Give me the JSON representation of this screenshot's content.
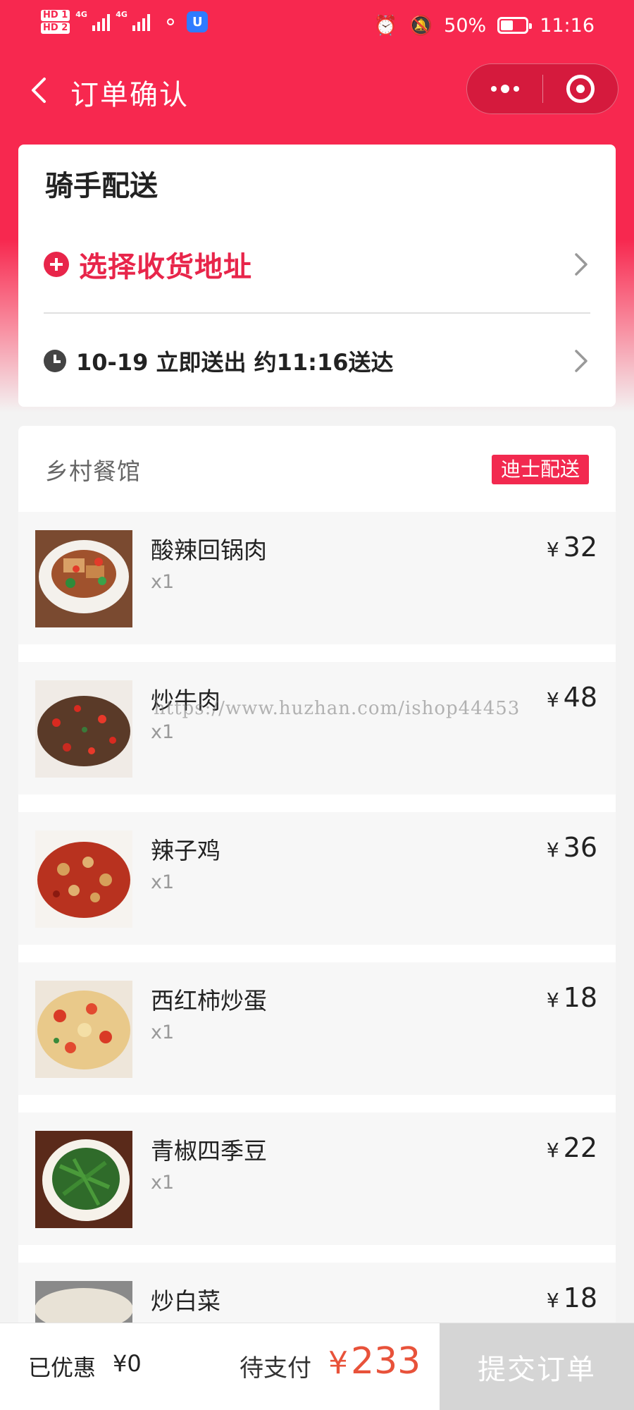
{
  "status_bar": {
    "hd1": "HD 1",
    "hd2": "HD 2",
    "net1": "4G",
    "net2": "4G",
    "battery_text": "50%",
    "battery_level": 0.5,
    "time": "11:16",
    "icons": [
      "alarm-icon",
      "mute-bell-icon",
      "battery-icon"
    ]
  },
  "nav": {
    "title": "订单确认",
    "back_icon": "chevron-left-icon",
    "more_icon": "more-dots-icon",
    "close_icon": "target-circle-icon"
  },
  "delivery": {
    "title": "骑手配送",
    "address_label": "选择收货地址",
    "time_label": "10-19 立即送出 约11:16送达"
  },
  "restaurant": {
    "name": "乡村餐馆",
    "badge": "迪士配送",
    "currency": "¥",
    "items": [
      {
        "name": "酸辣回锅肉",
        "qty": "x1",
        "price": "32"
      },
      {
        "name": "炒牛肉",
        "qty": "x1",
        "price": "48"
      },
      {
        "name": "辣子鸡",
        "qty": "x1",
        "price": "36"
      },
      {
        "name": "西红柿炒蛋",
        "qty": "x1",
        "price": "18"
      },
      {
        "name": "青椒四季豆",
        "qty": "x1",
        "price": "22"
      },
      {
        "name": "炒白菜",
        "qty": "",
        "price": "18"
      }
    ]
  },
  "watermark": "https://www.huzhan.com/ishop44453",
  "footer": {
    "discount_label": "已优惠",
    "discount_value": "¥0",
    "pay_label": "待支付",
    "currency": "¥",
    "pay_amount": "233",
    "submit_label": "提交订单"
  },
  "colors": {
    "brand_red": "#f7284f",
    "price_orange": "#e8523a",
    "submit_disabled": "#d5d5d5"
  }
}
